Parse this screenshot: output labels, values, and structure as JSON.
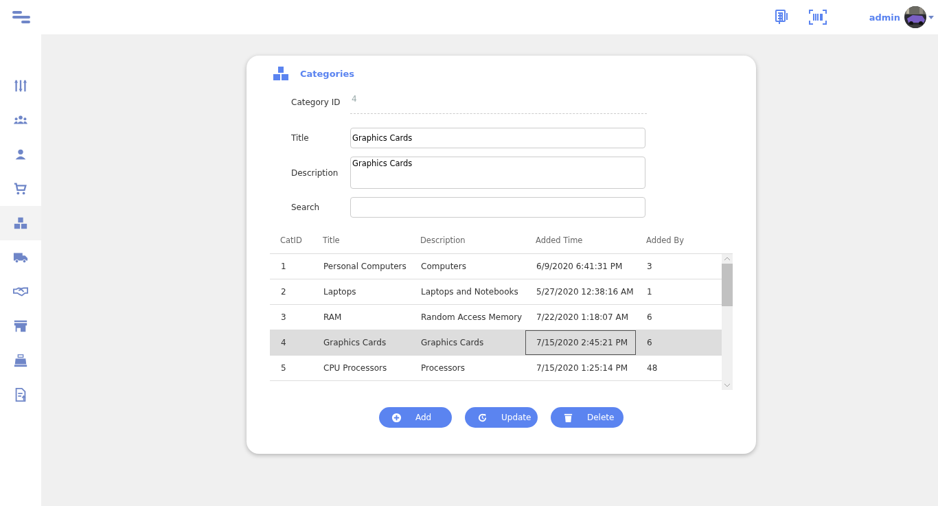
{
  "topbar": {
    "user": "admin"
  },
  "sidebar": {
    "items": [
      {
        "kind": "sliders",
        "selected": false
      },
      {
        "kind": "group",
        "selected": false
      },
      {
        "kind": "person",
        "selected": false
      },
      {
        "kind": "cart",
        "selected": false
      },
      {
        "kind": "boxes",
        "selected": true
      },
      {
        "kind": "truck",
        "selected": false
      },
      {
        "kind": "handshake",
        "selected": false
      },
      {
        "kind": "store",
        "selected": false
      },
      {
        "kind": "register",
        "selected": false
      },
      {
        "kind": "report",
        "selected": false
      }
    ]
  },
  "card": {
    "title": "Categories",
    "form": [
      {
        "kind": "readonly",
        "label": "Category ID",
        "value": "4"
      },
      {
        "kind": "input",
        "label": "Title",
        "value": "Graphics Cards"
      },
      {
        "kind": "textarea",
        "label": "Description",
        "value": "Graphics Cards"
      },
      {
        "kind": "input",
        "label": "Search"
      }
    ],
    "table": {
      "columns": [
        "CatID",
        "Title",
        "Description",
        "Added Time",
        "Added By"
      ],
      "rows": [
        {
          "selected": false,
          "cells": [
            {
              "text": "1",
              "focused": false
            },
            {
              "text": "Personal Computers",
              "focused": false
            },
            {
              "text": "Computers",
              "focused": false
            },
            {
              "text": "6/9/2020 6:41:31 PM",
              "focused": false
            },
            {
              "text": "3",
              "focused": false
            }
          ]
        },
        {
          "selected": false,
          "cells": [
            {
              "text": "2",
              "focused": false
            },
            {
              "text": "Laptops",
              "focused": false
            },
            {
              "text": "Laptops and Notebooks",
              "focused": false
            },
            {
              "text": "5/27/2020 12:38:16 AM",
              "focused": false
            },
            {
              "text": "1",
              "focused": false
            }
          ]
        },
        {
          "selected": false,
          "cells": [
            {
              "text": "3",
              "focused": false
            },
            {
              "text": "RAM",
              "focused": false
            },
            {
              "text": "Random Access Memory",
              "focused": false
            },
            {
              "text": "7/22/2020 1:18:07 AM",
              "focused": false
            },
            {
              "text": "6",
              "focused": false
            }
          ]
        },
        {
          "selected": true,
          "cells": [
            {
              "text": "4",
              "focused": false
            },
            {
              "text": "Graphics Cards",
              "focused": false
            },
            {
              "text": "Graphics Cards",
              "focused": false
            },
            {
              "text": "7/15/2020 2:45:21 PM",
              "focused": true
            },
            {
              "text": "6",
              "focused": false
            }
          ]
        },
        {
          "selected": false,
          "cells": [
            {
              "text": "5",
              "focused": false
            },
            {
              "text": "CPU Processors",
              "focused": false
            },
            {
              "text": "Processors",
              "focused": false
            },
            {
              "text": "7/15/2020 1:25:14 PM",
              "focused": false
            },
            {
              "text": "48",
              "focused": false
            }
          ]
        }
      ]
    },
    "buttons": [
      {
        "kind": "add",
        "label": "Add"
      },
      {
        "kind": "update",
        "label": "Update"
      },
      {
        "kind": "delete",
        "label": "Delete"
      }
    ]
  }
}
